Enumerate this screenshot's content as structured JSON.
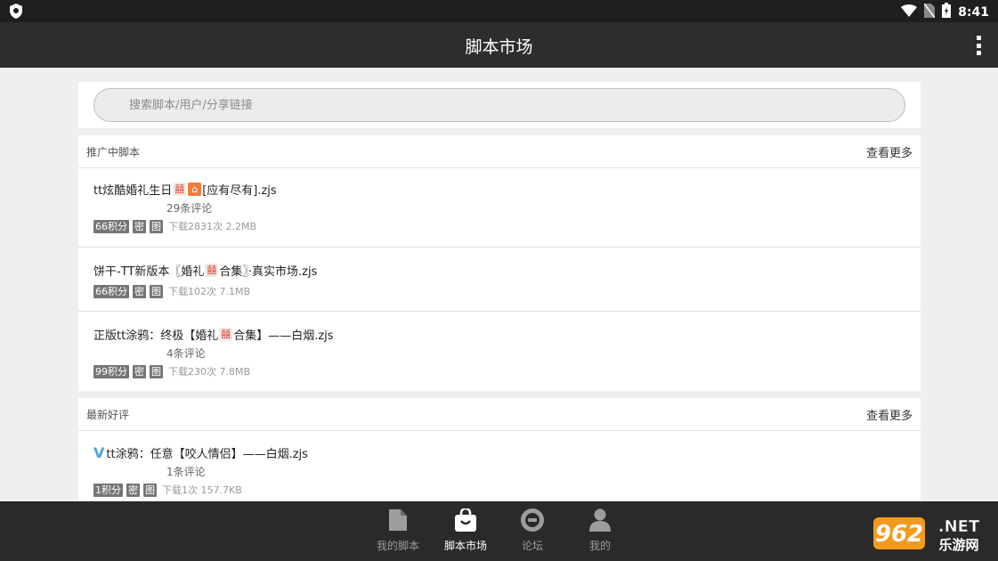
{
  "status_bar": {
    "time": "8:41"
  },
  "app_bar": {
    "title": "脚本市场"
  },
  "search": {
    "placeholder": "搜索脚本/用户/分享链接"
  },
  "sections": [
    {
      "title": "推广中脚本",
      "more": "查看更多",
      "items": [
        {
          "title_prefix": "tt炫酷婚礼生日",
          "title_suffix": "[应有尽有].zjs",
          "comments": "29条评论",
          "points": "66积分",
          "tag_secret": "密",
          "tag_image": "图",
          "stats": "下载2831次 2.2MB"
        },
        {
          "title_prefix": "饼干-TT新版本〖婚礼",
          "title_suffix": "合集〗·真实市场.zjs",
          "comments": "",
          "points": "66积分",
          "tag_secret": "密",
          "tag_image": "图",
          "stats": "下载102次 7.1MB"
        },
        {
          "title_prefix": "正版tt涂鸦：终极【婚礼",
          "title_suffix": "合集】——白烟.zjs",
          "comments": "4条评论",
          "points": "99积分",
          "tag_secret": "密",
          "tag_image": "图",
          "stats": "下载230次 7.8MB"
        }
      ]
    },
    {
      "title": "最新好评",
      "more": "查看更多",
      "items": [
        {
          "title_prefix": "tt涂鸦：任意【咬人情侣】——白烟.zjs",
          "comments": "1条评论",
          "points": "1积分",
          "tag_secret": "密",
          "tag_image": "图",
          "stats": "下载1次 157.7KB"
        }
      ]
    }
  ],
  "bottom_nav": [
    {
      "label": "我的脚本",
      "icon": "file-icon",
      "active": false
    },
    {
      "label": "脚本市场",
      "icon": "shopping-bag-icon",
      "active": true
    },
    {
      "label": "论坛",
      "icon": "forum-icon",
      "active": false
    },
    {
      "label": "我的",
      "icon": "person-icon",
      "active": false
    }
  ],
  "watermark": {
    "text": "962.NET",
    "subtext": "乐游网"
  },
  "colors": {
    "status_bar": "#1f1f1f",
    "app_bar": "#2d2d2d",
    "bottom_nav": "#2a2a2a",
    "tag": "#767676",
    "accent_v": "#4aa3e6"
  }
}
